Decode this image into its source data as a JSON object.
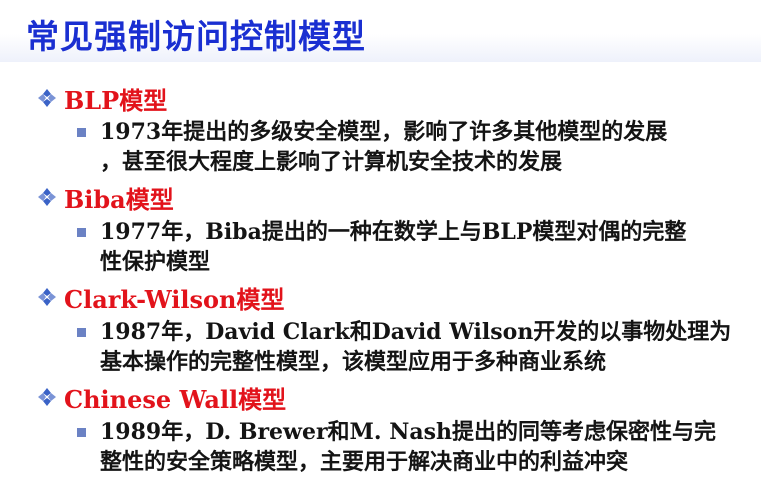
{
  "title": "常见强制访问控制模型",
  "colors": {
    "title": "#1a2fd1",
    "heading": "#e2131b",
    "bullet": "#6b82c4",
    "diamond": "#3b63c7"
  },
  "icons": {
    "heading_marker": "diamond-four-dots-icon",
    "sub_marker": "square-bullet-icon"
  },
  "sections": [
    {
      "heading": "BLP模型",
      "lines": [
        "1973年提出的多级安全模型，影响了许多其他模型的发展",
        "，甚至很大程度上影响了计算机安全技术的发展"
      ]
    },
    {
      "heading": "Biba模型",
      "lines": [
        "1977年，Biba提出的一种在数学上与BLP模型对偶的完整",
        "性保护模型"
      ]
    },
    {
      "heading": "Clark-Wilson模型",
      "lines": [
        "1987年，David Clark和David Wilson开发的以事物处理为",
        "基本操作的完整性模型，该模型应用于多种商业系统"
      ]
    },
    {
      "heading": "Chinese Wall模型",
      "lines": [
        "1989年，D. Brewer和M. Nash提出的同等考虑保密性与完",
        "整性的安全策略模型，主要用于解决商业中的利益冲突"
      ]
    }
  ]
}
